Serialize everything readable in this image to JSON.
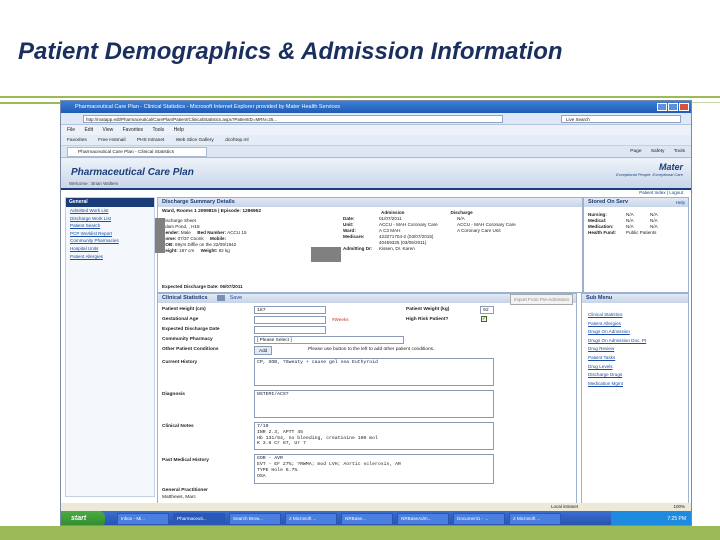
{
  "slide": {
    "title": "Patient Demographics & Admission Information"
  },
  "browser": {
    "title": "Pharmaceutical Care Plan - Clinical Statistics - Microsoft Internet Explorer provided by Mater Health Services",
    "url": "http://matapp.edt/Pharmaceutical/CarePlan/Patient/ClinicalStatistics.aspx?PatientID=MRN=25...",
    "live_search": "Live Search",
    "menu": [
      "File",
      "Edit",
      "View",
      "Favorites",
      "Tools",
      "Help"
    ],
    "favorites": [
      "Favorites",
      "Free Hotmail",
      "PHS Intranet",
      "Web Slice Gallery",
      "dcohtop.ml"
    ],
    "tab": "Pharmaceutical Care Plan - Clinical Statistics",
    "tools": [
      "Page",
      "Safety",
      "Tools"
    ]
  },
  "app": {
    "title": "Pharmaceutical Care Plan",
    "welcome": "Welcome : Brian Walters",
    "logo_name": "Mater",
    "logo_tagline": "Exceptional People. Exceptional Care",
    "topbar": "Patient Index | Logout"
  },
  "left_nav": {
    "header": "General",
    "items": [
      "Admitted Work List",
      "Discharge Work List",
      "Patient Search",
      "PCP Worklist Report",
      "Community Pharmacies",
      "Hospital Units",
      "Patient Allergies"
    ]
  },
  "discharge": {
    "header": "Discharge Summary Details",
    "ward_line": "Ward, Rooms 1 2099815 | Episode: 1286952",
    "rows": [
      {
        "l1": "",
        "v1": "Discharge Sheet",
        "l2": "",
        "v2": "",
        "l3": "Date:",
        "v3": "01/07/2011",
        "l4": "",
        "v4": "N/A"
      },
      {
        "l1": "",
        "v1": "Adam Pond, , H18",
        "l2": "",
        "v2": "",
        "l3": "Unit:",
        "v3": "ACCU - MAH Coronary Care",
        "l4": "",
        "v4": "ACCU - MAH Coronary Care"
      },
      {
        "l1": "Gender:",
        "v1": "Male",
        "l2": "Bed Number:",
        "v2": "ACCU 15",
        "l3": "Ward:",
        "v3": "A C3 MAH",
        "l4": "",
        "v4": "A Coronary Care Unit"
      },
      {
        "l1": "Home:",
        "v1": "07/37 Coonk",
        "l2": "Mobile:",
        "v2": "",
        "l3": "Medicare:",
        "v3": "423271704-2 (03/07/2015)",
        "l4": "",
        "v4": ""
      },
      {
        "l1": "DOB:",
        "v1": "69yrs Diffie on the 22/09/1942",
        "l2": "",
        "v2": "",
        "l3": "",
        "v3": "40459325 (03/09/2011)",
        "l4": "",
        "v4": ""
      },
      {
        "l1": "Height:",
        "v1": "187 cm",
        "l2": "Weight:",
        "v2": "92 kg",
        "l3": "Admitting Dr:",
        "v3": "Kissen, Dr. Karen",
        "l4": "",
        "v4": ""
      }
    ],
    "admission_label": "Admission",
    "discharge_label": "Discharge",
    "expected": "Expected Discharge Date: 06/07/2011"
  },
  "right_info": {
    "header": "Stored On  Serv",
    "help": "Help",
    "rows": [
      {
        "label": "Nursing:",
        "v1": "N/A",
        "v2": "N/A"
      },
      {
        "label": "Medical:",
        "v1": "N/A",
        "v2": "N/A"
      },
      {
        "label": "Medication:",
        "v1": "N/A",
        "v2": "N/A"
      },
      {
        "label": "Health Fund:",
        "v1": "Public Patients",
        "v2": ""
      }
    ]
  },
  "clinical": {
    "header": "Clinical Statistics",
    "save": "Save",
    "import_btn": "Import From Pre-Admission",
    "height_label": "Patient Height (cm)",
    "height_value": "187",
    "weight_label": "Patient Weight (kg)",
    "weight_value": "92",
    "gest_label": "Gestational Age",
    "weeks": "#Weeks",
    "high_risk_label": "High Risk Patient?",
    "exp_label": "Expected Discharge Date",
    "pharmacy_label": "Community Pharmacy",
    "pharmacy_value": "[ Please Select ]",
    "conditions_label": "Other Patient Conditions",
    "add": "Add",
    "add_note": "Please use button to the left to add other patient conditions.",
    "history_label": "Current History",
    "history_value": "CP, SOB, ?Sweaty + cause gel sea Euthyroid",
    "diagnosis_label": "Diagnosis",
    "diagnosis_value": "NSTEMI/ACS?",
    "notes_label": "Clinical Notes",
    "notes_lines": [
      "7/10",
      "INR 2.3, APTT 45",
      "Hb 131/84, no bleeding, creatinine 100 mol",
      "K 3.6 Cr 87, Ur 7"
    ],
    "pmh_label": "Past Medical History",
    "pmh_lines": [
      "GOR - AVR",
      "EVT - EF 27%; ?RWMA; mod LVH; Aortic sclerosis, AR",
      "TYPE   Hole 6.7%",
      "OSA"
    ],
    "gp_label": "General Practitioner",
    "gp_value": "Matthews, Marc"
  },
  "submenu": {
    "header": "Sub Menu",
    "items": [
      "Clinical Statistics",
      "Patient Allergies",
      "Drugs On Admission",
      "Drugs On Admission Doc. Pt",
      "Drug Review",
      "Patient Tasks",
      "Drug Levels",
      "Discharge Drugs",
      "Medication Mgmt"
    ]
  },
  "status": {
    "zone": "Local intranet",
    "zoom": "100%"
  },
  "taskbar": {
    "start": "start",
    "tasks": [
      "Inbox - Mi...",
      "Pharmaceuti...",
      "Search Brow...",
      "2 Microsoft ...",
      "NRBase...",
      "NRBaseAdm...",
      "Document1 - ...",
      "2 Microsoft ..."
    ],
    "clock": "7:25 PM"
  }
}
